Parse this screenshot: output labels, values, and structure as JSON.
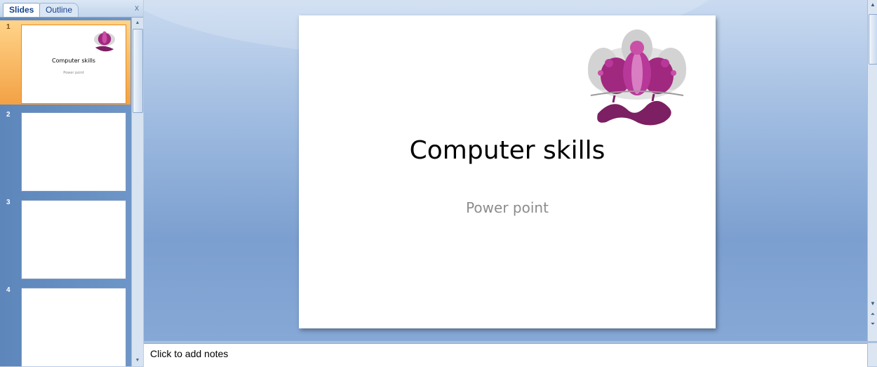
{
  "panel": {
    "tabs": [
      {
        "label": "Slides"
      },
      {
        "label": "Outline"
      }
    ],
    "close_glyph": "x",
    "slides": [
      {
        "number": "1",
        "title": "Computer skills",
        "subtitle": "Power point"
      },
      {
        "number": "2"
      },
      {
        "number": "3"
      },
      {
        "number": "4"
      }
    ]
  },
  "slide": {
    "title": "Computer skills",
    "subtitle": "Power point"
  },
  "notes": {
    "placeholder": "Click to add notes"
  },
  "colors": {
    "selected_thumb": "#f3a144",
    "logo_magenta": "#a0287f",
    "logo_grey": "#c9c9c9"
  }
}
